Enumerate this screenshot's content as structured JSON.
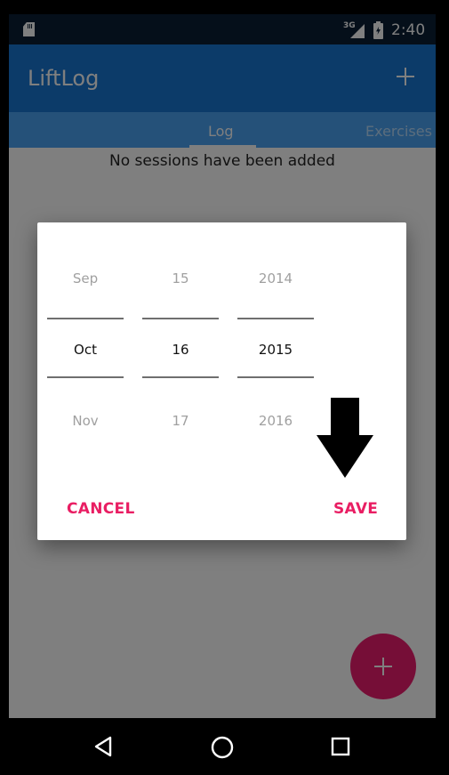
{
  "status_bar": {
    "network_type": "3G",
    "time": "2:40",
    "sd_icon": "sd-card-icon",
    "signal_icon": "cell-signal-icon",
    "battery_icon": "battery-charging-icon"
  },
  "app_bar": {
    "title": "LiftLog",
    "add_icon": "plus-icon",
    "color": "#1976d2"
  },
  "tabs": [
    {
      "label": "Log",
      "selected": true
    },
    {
      "label": "Exercises",
      "selected": false
    }
  ],
  "content": {
    "empty_message": "No sessions have been added"
  },
  "fab": {
    "icon": "plus-icon",
    "color": "#ec1d6e"
  },
  "date_picker": {
    "month": {
      "prev": "Sep",
      "selected": "Oct",
      "next": "Nov"
    },
    "day": {
      "prev": "15",
      "selected": "16",
      "next": "17"
    },
    "year": {
      "prev": "2014",
      "selected": "2015",
      "next": "2016"
    },
    "cancel_label": "CANCEL",
    "save_label": "SAVE",
    "accent_color": "#e91e63"
  },
  "annotation": {
    "icon": "down-arrow-icon"
  },
  "nav_bar": {
    "back_icon": "back-triangle-icon",
    "home_icon": "home-circle-icon",
    "recents_icon": "recents-square-icon"
  }
}
